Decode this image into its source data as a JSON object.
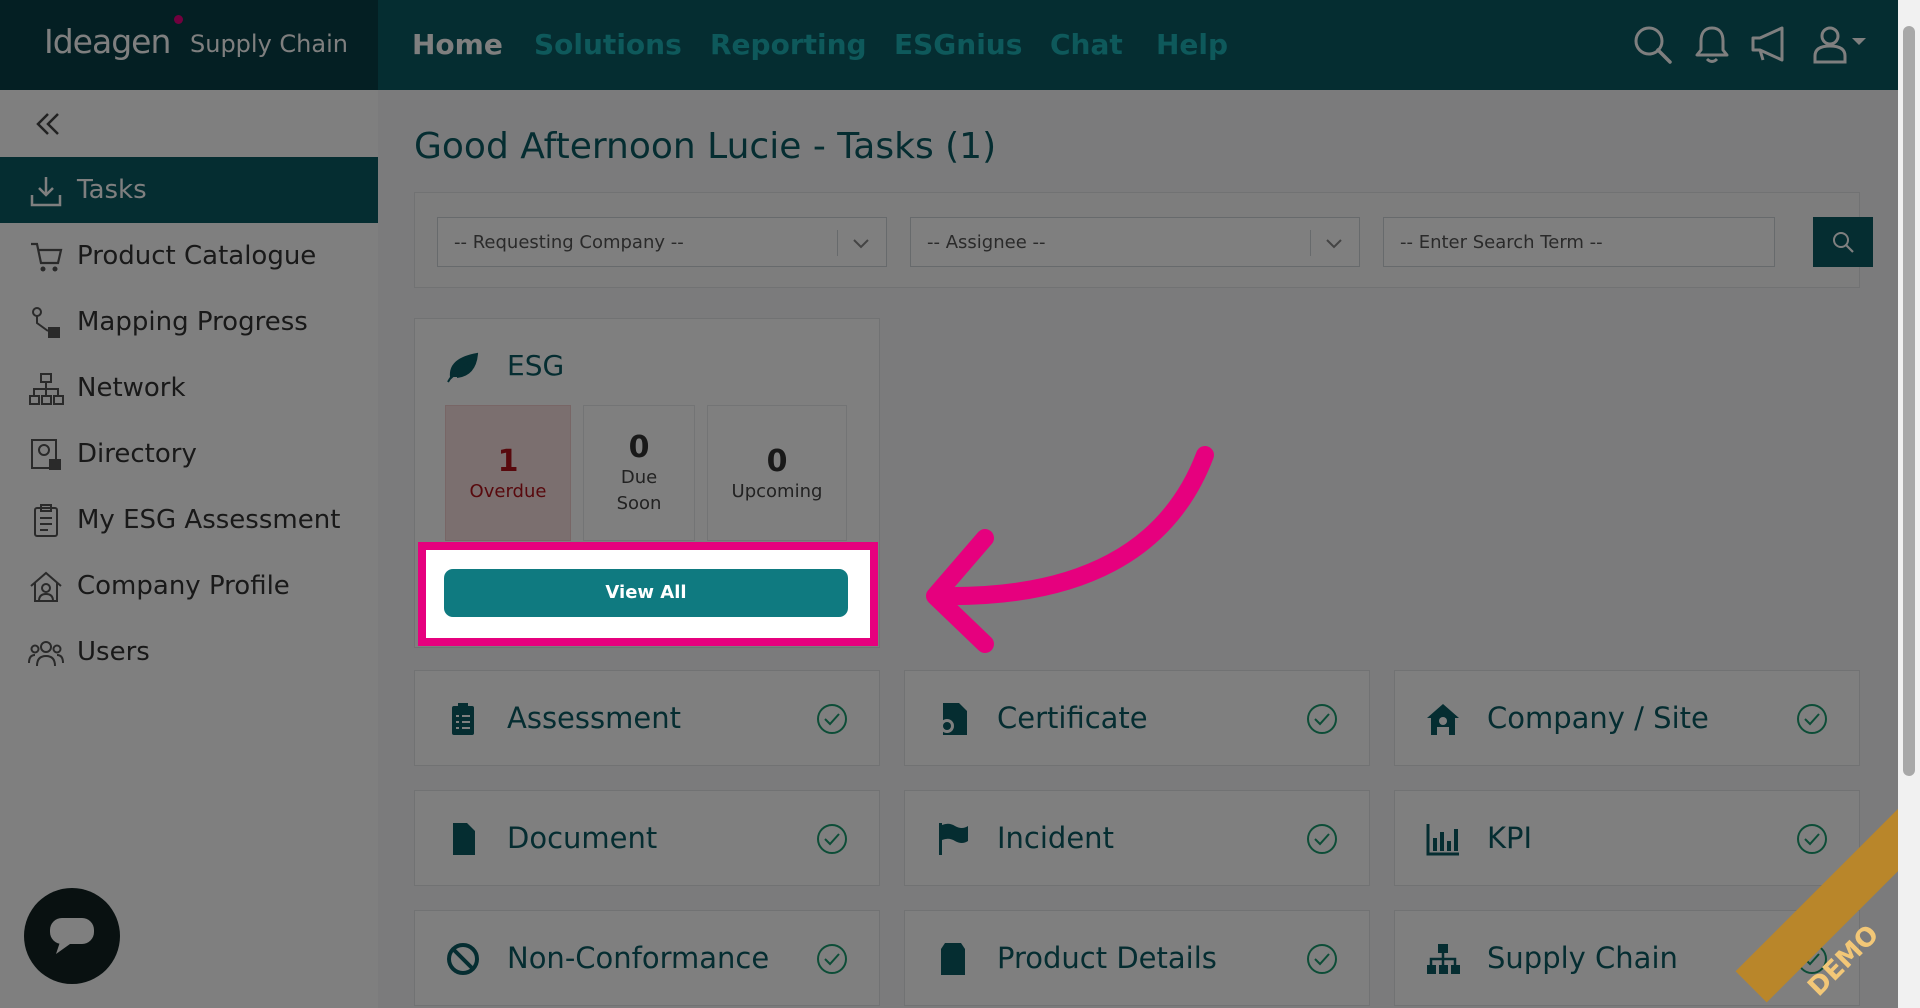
{
  "app": {
    "brand": "Ideagen",
    "brand_sub": "Supply Chain"
  },
  "nav": [
    "Home",
    "Solutions",
    "Reporting",
    "ESGnius",
    "Chat",
    "Help"
  ],
  "header_icons": [
    "search-icon",
    "bell-icon",
    "megaphone-icon",
    "user-icon"
  ],
  "sidebar": {
    "items": [
      {
        "label": "Tasks",
        "icon": "download-icon"
      },
      {
        "label": "Product Catalogue",
        "icon": "cart-icon"
      },
      {
        "label": "Mapping Progress",
        "icon": "mapping-icon"
      },
      {
        "label": "Network",
        "icon": "network-icon"
      },
      {
        "label": "Directory",
        "icon": "directory-icon"
      },
      {
        "label": "My ESG Assessment",
        "icon": "clipboard-icon"
      },
      {
        "label": "Company Profile",
        "icon": "home-user-icon"
      },
      {
        "label": "Users",
        "icon": "users-icon"
      }
    ]
  },
  "main": {
    "title": "Good Afternoon Lucie - Tasks (1)",
    "filters": {
      "requesting_company": "-- Requesting Company --",
      "assignee": "-- Assignee --",
      "search_placeholder": "-- Enter Search Term --"
    },
    "esg": {
      "title": "ESG",
      "stats": [
        {
          "num": "1",
          "label": "Overdue"
        },
        {
          "num": "0",
          "label": "Due Soon"
        },
        {
          "num": "0",
          "label": "Upcoming"
        }
      ],
      "view_all": "View All"
    },
    "tiles": [
      {
        "label": "Assessment",
        "icon": "clipboard-list-icon"
      },
      {
        "label": "Certificate",
        "icon": "certificate-icon"
      },
      {
        "label": "Company / Site",
        "icon": "house-icon"
      },
      {
        "label": "Document",
        "icon": "document-icon"
      },
      {
        "label": "Incident",
        "icon": "flag-icon"
      },
      {
        "label": "KPI",
        "icon": "bar-chart-icon"
      },
      {
        "label": "Non-Conformance",
        "icon": "ban-icon"
      },
      {
        "label": "Product Details",
        "icon": "box-icon"
      },
      {
        "label": "Supply Chain",
        "icon": "hierarchy-icon"
      }
    ]
  },
  "watermark": "DEMO",
  "colors": {
    "primary": "#0b5a63",
    "accent": "#e6007e",
    "nav_inactive": "#1db2b6"
  }
}
